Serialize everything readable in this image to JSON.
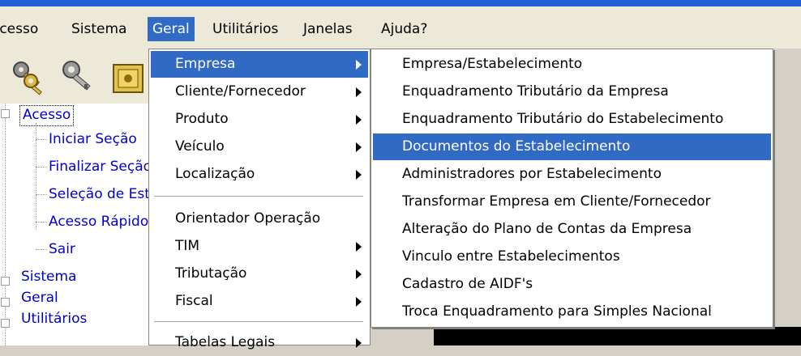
{
  "menubar": {
    "items": [
      {
        "label": "Acesso",
        "active": false
      },
      {
        "label": "Sistema",
        "active": false
      },
      {
        "label": "Geral",
        "active": true
      },
      {
        "label": "Utilitários",
        "active": false
      },
      {
        "label": "Janelas",
        "active": false
      },
      {
        "label": "Ajuda?",
        "active": false
      }
    ]
  },
  "toolbar": {
    "icons": [
      "keys-icon",
      "key-icon",
      "safe-icon"
    ]
  },
  "tree": {
    "root": "Acesso",
    "children": [
      "Iniciar Seção",
      "Finalizar Seção",
      "Seleção de Estabelecimento",
      "Acesso Rápido",
      "Sair"
    ],
    "siblings": [
      "Sistema",
      "Geral",
      "Utilitários"
    ]
  },
  "geral_menu": {
    "items": [
      {
        "label": "Empresa",
        "submenu": true,
        "highlighted": true
      },
      {
        "label": "Cliente/Fornecedor",
        "submenu": true
      },
      {
        "label": "Produto",
        "submenu": true
      },
      {
        "label": "Veículo",
        "submenu": true
      },
      {
        "label": "Localização",
        "submenu": true
      },
      {
        "label": "Orientador Operação",
        "submenu": false
      },
      {
        "label": "TIM",
        "submenu": true
      },
      {
        "label": "Tributação",
        "submenu": true
      },
      {
        "label": "Fiscal",
        "submenu": true
      },
      {
        "label": "Tabelas Legais",
        "submenu": true
      }
    ]
  },
  "empresa_submenu": {
    "items": [
      {
        "label": "Empresa/Estabelecimento"
      },
      {
        "label": "Enquadramento Tributário da Empresa"
      },
      {
        "label": "Enquadramento Tributário do Estabelecimento"
      },
      {
        "label": "Documentos do Estabelecimento",
        "highlighted": true
      },
      {
        "label": "Administradores por Estabelecimento"
      },
      {
        "label": "Transformar Empresa em Cliente/Fornecedor"
      },
      {
        "label": "Alteração do Plano de Contas da Empresa"
      },
      {
        "label": "Vinculo entre Estabelecimentos"
      },
      {
        "label": "Cadastro de AIDF's"
      },
      {
        "label": "Troca Enquadramento para Simples Nacional"
      }
    ]
  },
  "colors": {
    "highlight": "#316ac5",
    "tree_link": "#0000cc",
    "menubar_bg": "#ece9d8"
  }
}
